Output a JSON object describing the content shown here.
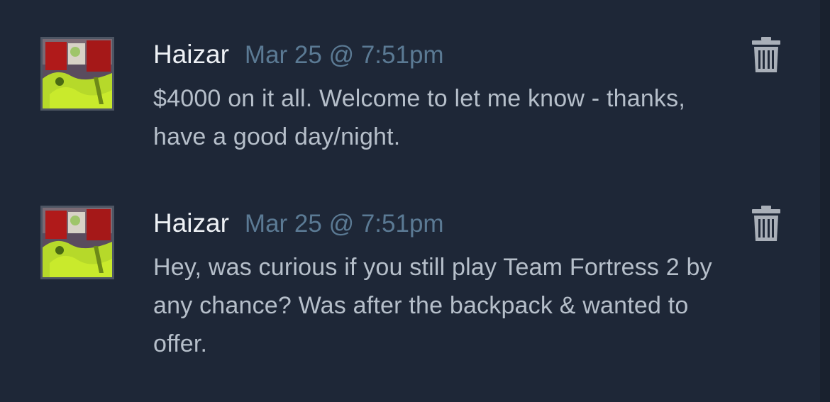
{
  "comments": [
    {
      "author": "Haizar",
      "timestamp": "Mar 25 @ 7:51pm",
      "text": "$4000 on it all. Welcome to let me know - thanks, have a good day/night.",
      "avatar_icon": "user-avatar",
      "delete_icon": "trash-icon"
    },
    {
      "author": "Haizar",
      "timestamp": "Mar 25 @ 7:51pm",
      "text": "Hey, was curious if you still play Team Fortress 2 by any chance? Was after the backpack & wanted to offer.",
      "avatar_icon": "user-avatar",
      "delete_icon": "trash-icon"
    }
  ],
  "colors": {
    "background": "#1e2737",
    "author": "#eef1f5",
    "timestamp": "#5b7a94",
    "body_text": "#b6bfca",
    "icon": "#a9afb8"
  }
}
